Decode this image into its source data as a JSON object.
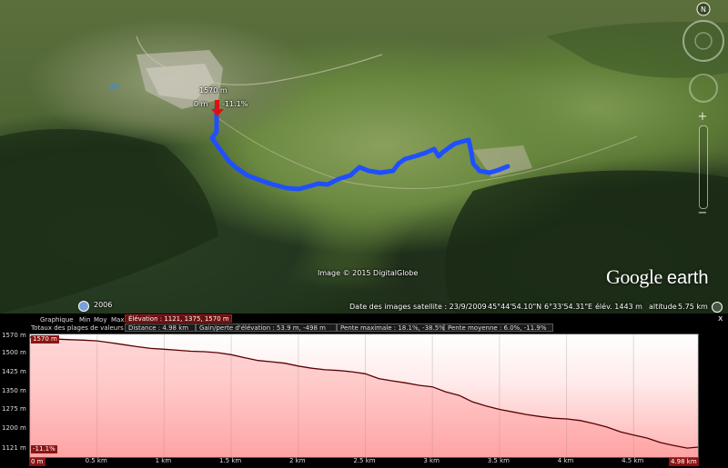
{
  "map": {
    "copyright": "Image © 2015 DigitalGlobe",
    "date_images": "Date des images satellite : 23/9/2009",
    "latitude": "45°44'54.10\"N",
    "longitude": "6°33'54.31\"E",
    "elevation_view": "élév. 1443 m",
    "altitude_label": "altitude",
    "altitude_value": "5.75 km",
    "year": "2006",
    "logo_google": "Google",
    "logo_earth": "earth",
    "marker": {
      "elevation": "1570 m",
      "left": "0 m",
      "right": "-11.1%"
    },
    "icons": {
      "north": "compass-icon",
      "zoom_plus": "zoom-in-icon",
      "zoom_minus": "zoom-out-icon",
      "time": "clock-icon",
      "view": "eye-icon"
    }
  },
  "panel": {
    "graph_label": "Graphique",
    "min_label": "Min",
    "avg_label": "Moy",
    "max_label": "Max",
    "totals_label": "Totaux des plages de valeurs",
    "close": "x",
    "stats": {
      "elevation": "Élévation : 1121, 1375, 1570 m",
      "distance": "Distance : 4.98 km",
      "gain": "Gain/perte d'élévation : 53.9 m, -498 m",
      "max_slope": "Pente maximale : 18.1%, -38.5%",
      "avg_slope": "Pente moyenne : 6.0%, -11.9%"
    },
    "tags": {
      "max": "1570 m",
      "slope": "-11.1%",
      "zero": "0 m",
      "end": "4.98 km"
    }
  },
  "colors": {
    "route": "#1f4fff",
    "profile_line": "#5a0000",
    "profile_fill_top": "#ffffff",
    "profile_fill_bottom": "#ffb0b0",
    "highlight": "#8c1414"
  },
  "chart_data": {
    "type": "area",
    "title": "",
    "xlabel": "",
    "ylabel": "",
    "xlim": [
      0,
      4.98
    ],
    "ylim": [
      1121,
      1570
    ],
    "x_ticks": [
      "0 m",
      "0.5 km",
      "1 km",
      "1.5 km",
      "2 km",
      "2.5 km",
      "3 km",
      "3.5 km",
      "4 km",
      "4.5 km",
      "4.98 km"
    ],
    "y_ticks": [
      "1570 m",
      "1500 m",
      "1425 m",
      "1350 m",
      "1275 m",
      "1200 m",
      "1121 m"
    ],
    "series": [
      {
        "x": [
          0,
          0.1,
          0.2,
          0.3,
          0.4,
          0.5,
          0.6,
          0.7,
          0.8,
          0.9,
          1.0,
          1.1,
          1.2,
          1.3,
          1.4,
          1.5,
          1.6,
          1.7,
          1.8,
          1.9,
          2.0,
          2.1,
          2.2,
          2.3,
          2.4,
          2.5,
          2.6,
          2.7,
          2.8,
          2.9,
          3.0,
          3.1,
          3.2,
          3.3,
          3.4,
          3.5,
          3.6,
          3.7,
          3.8,
          3.9,
          4.0,
          4.1,
          4.2,
          4.3,
          4.4,
          4.5,
          4.6,
          4.7,
          4.8,
          4.9,
          4.98
        ],
        "values": [
          1570,
          1566,
          1562,
          1560,
          1558,
          1555,
          1548,
          1540,
          1532,
          1525,
          1522,
          1518,
          1514,
          1512,
          1508,
          1500,
          1488,
          1477,
          1472,
          1466,
          1455,
          1446,
          1440,
          1437,
          1432,
          1424,
          1405,
          1396,
          1388,
          1378,
          1372,
          1352,
          1338,
          1312,
          1296,
          1282,
          1272,
          1262,
          1254,
          1247,
          1244,
          1238,
          1226,
          1212,
          1193,
          1180,
          1168,
          1150,
          1138,
          1128,
          1132
        ]
      }
    ]
  }
}
